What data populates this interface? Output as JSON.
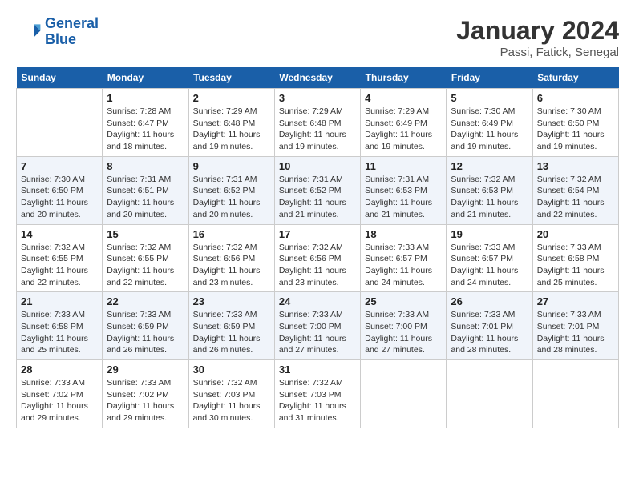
{
  "header": {
    "logo_line1": "General",
    "logo_line2": "Blue",
    "title": "January 2024",
    "location": "Passi, Fatick, Senegal"
  },
  "days_of_week": [
    "Sunday",
    "Monday",
    "Tuesday",
    "Wednesday",
    "Thursday",
    "Friday",
    "Saturday"
  ],
  "weeks": [
    [
      {
        "num": "",
        "sunrise": "",
        "sunset": "",
        "daylight": ""
      },
      {
        "num": "1",
        "sunrise": "7:28 AM",
        "sunset": "6:47 PM",
        "daylight": "11 hours and 18 minutes."
      },
      {
        "num": "2",
        "sunrise": "7:29 AM",
        "sunset": "6:48 PM",
        "daylight": "11 hours and 19 minutes."
      },
      {
        "num": "3",
        "sunrise": "7:29 AM",
        "sunset": "6:48 PM",
        "daylight": "11 hours and 19 minutes."
      },
      {
        "num": "4",
        "sunrise": "7:29 AM",
        "sunset": "6:49 PM",
        "daylight": "11 hours and 19 minutes."
      },
      {
        "num": "5",
        "sunrise": "7:30 AM",
        "sunset": "6:49 PM",
        "daylight": "11 hours and 19 minutes."
      },
      {
        "num": "6",
        "sunrise": "7:30 AM",
        "sunset": "6:50 PM",
        "daylight": "11 hours and 19 minutes."
      }
    ],
    [
      {
        "num": "7",
        "sunrise": "7:30 AM",
        "sunset": "6:50 PM",
        "daylight": "11 hours and 20 minutes."
      },
      {
        "num": "8",
        "sunrise": "7:31 AM",
        "sunset": "6:51 PM",
        "daylight": "11 hours and 20 minutes."
      },
      {
        "num": "9",
        "sunrise": "7:31 AM",
        "sunset": "6:52 PM",
        "daylight": "11 hours and 20 minutes."
      },
      {
        "num": "10",
        "sunrise": "7:31 AM",
        "sunset": "6:52 PM",
        "daylight": "11 hours and 21 minutes."
      },
      {
        "num": "11",
        "sunrise": "7:31 AM",
        "sunset": "6:53 PM",
        "daylight": "11 hours and 21 minutes."
      },
      {
        "num": "12",
        "sunrise": "7:32 AM",
        "sunset": "6:53 PM",
        "daylight": "11 hours and 21 minutes."
      },
      {
        "num": "13",
        "sunrise": "7:32 AM",
        "sunset": "6:54 PM",
        "daylight": "11 hours and 22 minutes."
      }
    ],
    [
      {
        "num": "14",
        "sunrise": "7:32 AM",
        "sunset": "6:55 PM",
        "daylight": "11 hours and 22 minutes."
      },
      {
        "num": "15",
        "sunrise": "7:32 AM",
        "sunset": "6:55 PM",
        "daylight": "11 hours and 22 minutes."
      },
      {
        "num": "16",
        "sunrise": "7:32 AM",
        "sunset": "6:56 PM",
        "daylight": "11 hours and 23 minutes."
      },
      {
        "num": "17",
        "sunrise": "7:32 AM",
        "sunset": "6:56 PM",
        "daylight": "11 hours and 23 minutes."
      },
      {
        "num": "18",
        "sunrise": "7:33 AM",
        "sunset": "6:57 PM",
        "daylight": "11 hours and 24 minutes."
      },
      {
        "num": "19",
        "sunrise": "7:33 AM",
        "sunset": "6:57 PM",
        "daylight": "11 hours and 24 minutes."
      },
      {
        "num": "20",
        "sunrise": "7:33 AM",
        "sunset": "6:58 PM",
        "daylight": "11 hours and 25 minutes."
      }
    ],
    [
      {
        "num": "21",
        "sunrise": "7:33 AM",
        "sunset": "6:58 PM",
        "daylight": "11 hours and 25 minutes."
      },
      {
        "num": "22",
        "sunrise": "7:33 AM",
        "sunset": "6:59 PM",
        "daylight": "11 hours and 26 minutes."
      },
      {
        "num": "23",
        "sunrise": "7:33 AM",
        "sunset": "6:59 PM",
        "daylight": "11 hours and 26 minutes."
      },
      {
        "num": "24",
        "sunrise": "7:33 AM",
        "sunset": "7:00 PM",
        "daylight": "11 hours and 27 minutes."
      },
      {
        "num": "25",
        "sunrise": "7:33 AM",
        "sunset": "7:00 PM",
        "daylight": "11 hours and 27 minutes."
      },
      {
        "num": "26",
        "sunrise": "7:33 AM",
        "sunset": "7:01 PM",
        "daylight": "11 hours and 28 minutes."
      },
      {
        "num": "27",
        "sunrise": "7:33 AM",
        "sunset": "7:01 PM",
        "daylight": "11 hours and 28 minutes."
      }
    ],
    [
      {
        "num": "28",
        "sunrise": "7:33 AM",
        "sunset": "7:02 PM",
        "daylight": "11 hours and 29 minutes."
      },
      {
        "num": "29",
        "sunrise": "7:33 AM",
        "sunset": "7:02 PM",
        "daylight": "11 hours and 29 minutes."
      },
      {
        "num": "30",
        "sunrise": "7:32 AM",
        "sunset": "7:03 PM",
        "daylight": "11 hours and 30 minutes."
      },
      {
        "num": "31",
        "sunrise": "7:32 AM",
        "sunset": "7:03 PM",
        "daylight": "11 hours and 31 minutes."
      },
      {
        "num": "",
        "sunrise": "",
        "sunset": "",
        "daylight": ""
      },
      {
        "num": "",
        "sunrise": "",
        "sunset": "",
        "daylight": ""
      },
      {
        "num": "",
        "sunrise": "",
        "sunset": "",
        "daylight": ""
      }
    ]
  ]
}
